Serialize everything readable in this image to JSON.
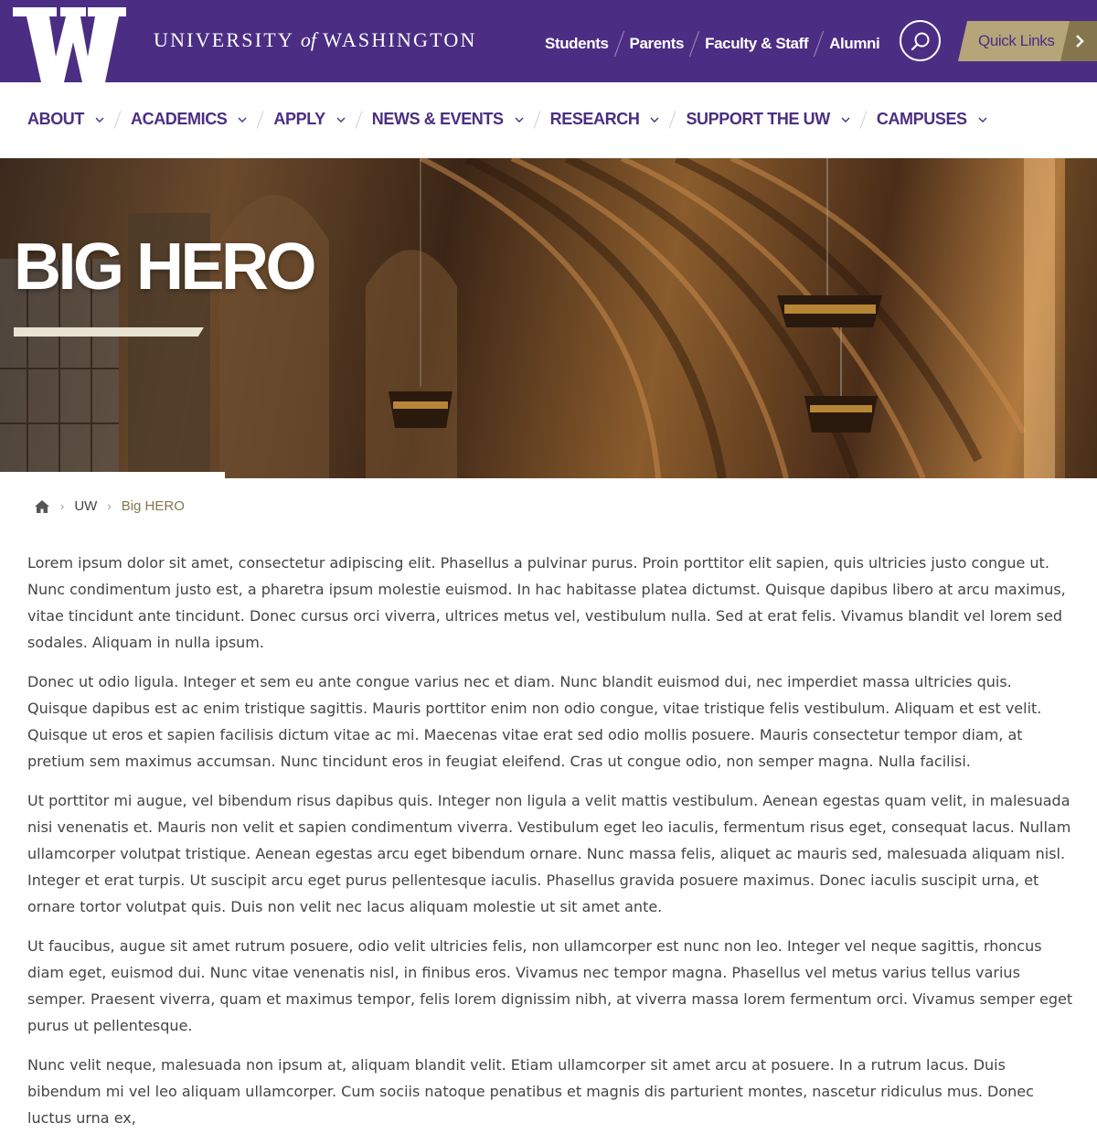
{
  "header": {
    "logo_letter": "W",
    "wordmark": {
      "part1": "UNIVERSITY ",
      "part2": "of",
      "part3": " WASHINGTON"
    },
    "audience_links": [
      "Students",
      "Parents",
      "Faculty & Staff",
      "Alumni"
    ],
    "quick_links_label": "Quick Links",
    "icons": {
      "search": "search-icon",
      "quick_links_arrow": "chevron-right-icon"
    },
    "colors": {
      "purple": "#4b2e83",
      "gold": "#b7a57a",
      "dark_gold": "#85754d"
    }
  },
  "main_nav": {
    "items": [
      {
        "label": "ABOUT"
      },
      {
        "label": "ACADEMICS"
      },
      {
        "label": "APPLY"
      },
      {
        "label": "NEWS & EVENTS"
      },
      {
        "label": "RESEARCH"
      },
      {
        "label": "SUPPORT THE UW"
      },
      {
        "label": "CAMPUSES"
      }
    ]
  },
  "hero": {
    "title": "BIG HERO"
  },
  "breadcrumb": {
    "home_icon": "home-icon",
    "items": [
      "UW",
      "Big HERO"
    ]
  },
  "content": {
    "paragraphs": [
      "Lorem ipsum dolor sit amet, consectetur adipiscing elit. Phasellus a pulvinar purus. Proin porttitor elit sapien, quis ultricies justo congue ut. Nunc condimentum justo est, a pharetra ipsum molestie euismod. In hac habitasse platea dictumst. Quisque dapibus libero at arcu maximus, vitae tincidunt ante tincidunt. Donec cursus orci viverra, ultrices metus vel, vestibulum nulla. Sed at erat felis. Vivamus blandit vel lorem sed sodales. Aliquam in nulla ipsum.",
      "Donec ut odio ligula. Integer et sem eu ante congue varius nec et diam. Nunc blandit euismod dui, nec imperdiet massa ultricies quis. Quisque dapibus est ac enim tristique sagittis. Mauris porttitor enim non odio congue, vitae tristique felis vestibulum. Aliquam et est velit. Quisque ut eros et sapien facilisis dictum vitae ac mi. Maecenas vitae erat sed odio mollis posuere. Mauris consectetur tempor diam, at pretium sem maximus accumsan. Nunc tincidunt eros in feugiat eleifend. Cras ut congue odio, non semper magna. Nulla facilisi.",
      "Ut porttitor mi augue, vel bibendum risus dapibus quis. Integer non ligula a velit mattis vestibulum. Aenean egestas quam velit, in malesuada nisi venenatis et. Mauris non velit et sapien condimentum viverra. Vestibulum eget leo iaculis, fermentum risus eget, consequat lacus. Nullam ullamcorper volutpat tristique. Aenean egestas arcu eget bibendum ornare. Nunc massa felis, aliquet ac mauris sed, malesuada aliquam nisl. Integer et erat turpis. Ut suscipit arcu eget purus pellentesque iaculis. Phasellus gravida posuere maximus. Donec iaculis suscipit urna, et ornare tortor volutpat quis. Duis non velit nec lacus aliquam molestie ut sit amet ante.",
      "Ut faucibus, augue sit amet rutrum posuere, odio velit ultricies felis, non ullamcorper est nunc non leo. Integer vel neque sagittis, rhoncus diam eget, euismod dui. Nunc vitae venenatis nisl, in finibus eros. Vivamus nec tempor magna. Phasellus vel metus varius tellus varius semper. Praesent viverra, quam et maximus tempor, felis lorem dignissim nibh, at viverra massa lorem fermentum orci. Vivamus semper eget purus ut pellentesque.",
      "Nunc velit neque, malesuada non ipsum at, aliquam blandit velit. Etiam ullamcorper sit amet arcu at posuere. In a rutrum lacus. Duis bibendum mi vel leo aliquam ullamcorper. Cum sociis natoque penatibus et magnis dis parturient montes, nascetur ridiculus mus. Donec luctus urna ex,"
    ]
  }
}
